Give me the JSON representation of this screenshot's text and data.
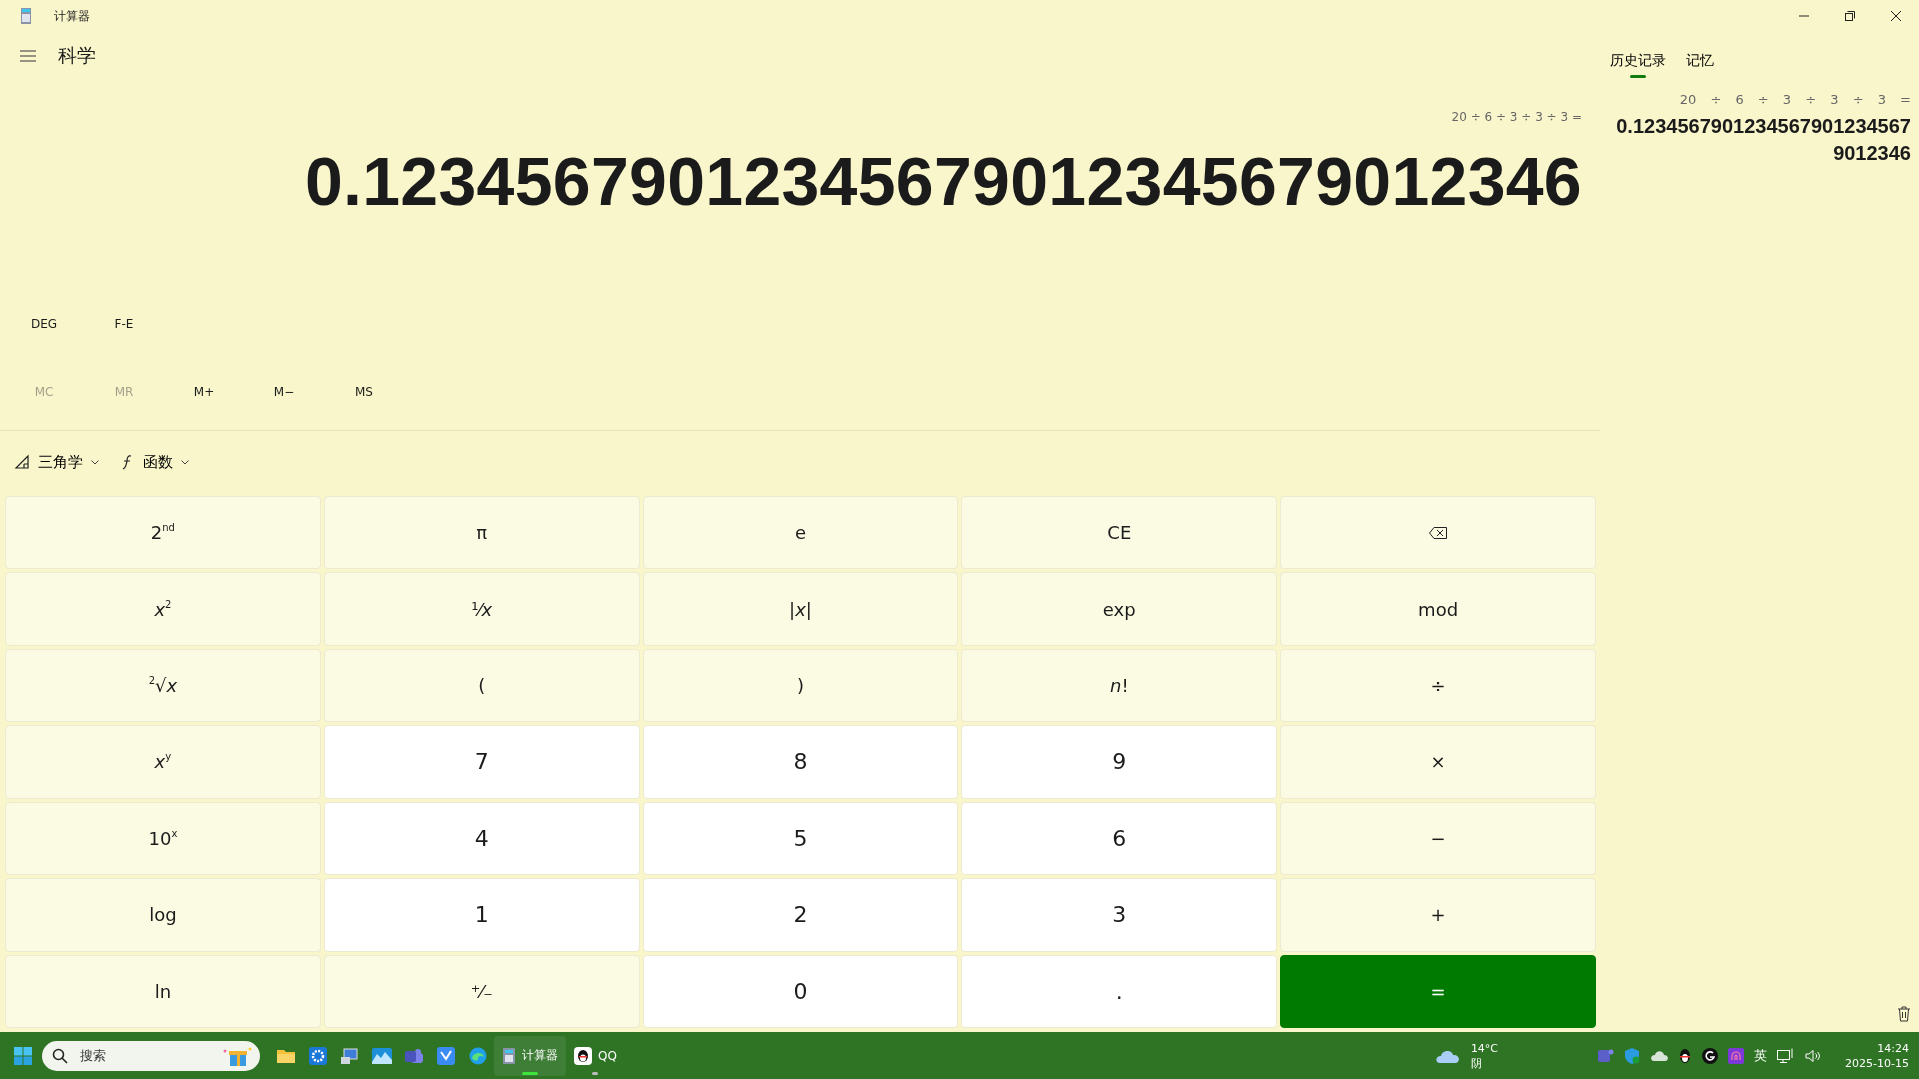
{
  "window": {
    "title": "计算器"
  },
  "header": {
    "mode": "科学"
  },
  "display": {
    "expression": "20 ÷ 6 ÷ 3 ÷ 3 ÷ 3 =",
    "value": "0.12345679012345679012345679012346"
  },
  "mode_buttons": [
    "DEG",
    "F-E"
  ],
  "memory_buttons": [
    {
      "label": "MC",
      "disabled": true
    },
    {
      "label": "MR",
      "disabled": true
    },
    {
      "label": "M+",
      "disabled": false
    },
    {
      "label": "M−",
      "disabled": false
    },
    {
      "label": "MS",
      "disabled": false
    }
  ],
  "function_menus": [
    {
      "label": "三角学",
      "kind": "triangle"
    },
    {
      "label": "函数",
      "kind": "function"
    }
  ],
  "keys": [
    {
      "label": "2$^{nd}$",
      "kind": "function"
    },
    {
      "label": "π",
      "kind": "function"
    },
    {
      "label": "e",
      "kind": "function"
    },
    {
      "label": "CE",
      "kind": "function"
    },
    {
      "kind": "backspace"
    },
    {
      "label": "*x*$^{2}$",
      "kind": "function"
    },
    {
      "label": "¹⁄*x*",
      "kind": "function"
    },
    {
      "label": "|*x*|",
      "kind": "function"
    },
    {
      "label": "exp",
      "kind": "function"
    },
    {
      "label": "mod",
      "kind": "function"
    },
    {
      "label": "$^{2}$√*x*",
      "kind": "function"
    },
    {
      "label": "(",
      "kind": "function"
    },
    {
      "label": ")",
      "kind": "function"
    },
    {
      "label": "*n*!",
      "kind": "function"
    },
    {
      "label": "÷",
      "kind": "operator"
    },
    {
      "label": "*x*$^{y}$",
      "kind": "function"
    },
    {
      "label": "7",
      "kind": "digit"
    },
    {
      "label": "8",
      "kind": "digit"
    },
    {
      "label": "9",
      "kind": "digit"
    },
    {
      "label": "×",
      "kind": "operator"
    },
    {
      "label": "10$^{x}$",
      "kind": "function"
    },
    {
      "label": "4",
      "kind": "digit"
    },
    {
      "label": "5",
      "kind": "digit"
    },
    {
      "label": "6",
      "kind": "digit"
    },
    {
      "label": "−",
      "kind": "operator"
    },
    {
      "label": "log",
      "kind": "function"
    },
    {
      "label": "1",
      "kind": "digit"
    },
    {
      "label": "2",
      "kind": "digit"
    },
    {
      "label": "3",
      "kind": "digit"
    },
    {
      "label": "+",
      "kind": "operator"
    },
    {
      "label": "ln",
      "kind": "function"
    },
    {
      "label": "⁺⁄₋",
      "kind": "function"
    },
    {
      "label": "0",
      "kind": "digit"
    },
    {
      "label": ".",
      "kind": "digit"
    },
    {
      "label": "=",
      "kind": "equals"
    }
  ],
  "panel_tabs": [
    {
      "label": "历史记录",
      "selected": true
    },
    {
      "label": "记忆",
      "selected": false
    }
  ],
  "history": [
    {
      "expression": "20 ÷ 6 ÷ 3 ÷ 3 ÷ 3 =",
      "result": "0.12345679012345679012345679012346"
    }
  ],
  "taskbar": {
    "search": {
      "placeholder": "搜索"
    },
    "apps": [
      {
        "label": "计算器",
        "kind": "calculator",
        "selected": true
      },
      {
        "label": "QQ",
        "kind": "qq",
        "selected": false
      }
    ],
    "weather": {
      "temperature": "14°C",
      "condition": "阴"
    },
    "input_method": "英",
    "time": "14:24",
    "date": "2025-10-15"
  }
}
